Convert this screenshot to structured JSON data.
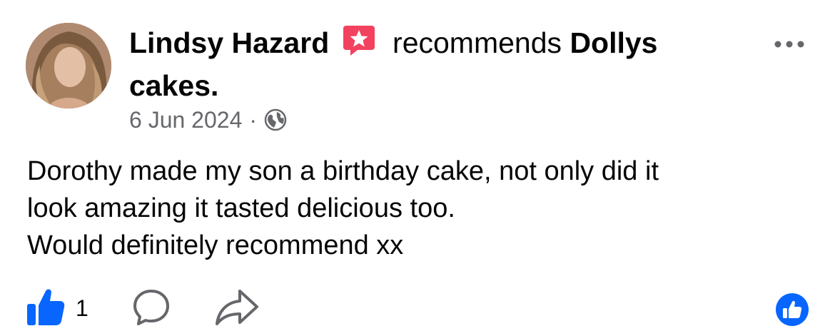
{
  "post": {
    "author": "Lindsy Hazard",
    "action": "recommends",
    "page_name": "Dollys",
    "page_name_cont": "cakes.",
    "date": "6 Jun 2024",
    "separator": "·",
    "lines": [
      "Dorothy made my son a birthday cake, not only did it",
      "look amazing it tasted delicious too.",
      "Would definitely recommend xx"
    ]
  },
  "actions": {
    "like_count": "1"
  },
  "icons": {
    "badge": "recommend-star-icon",
    "more": "more-options-icon",
    "audience": "globe-icon",
    "like": "thumbs-up-icon",
    "comment": "comment-icon",
    "share": "share-icon",
    "reaction": "like-reaction-icon"
  },
  "colors": {
    "badge": "#f3425f",
    "like": "#0866ff",
    "secondary_text": "#65676b"
  }
}
